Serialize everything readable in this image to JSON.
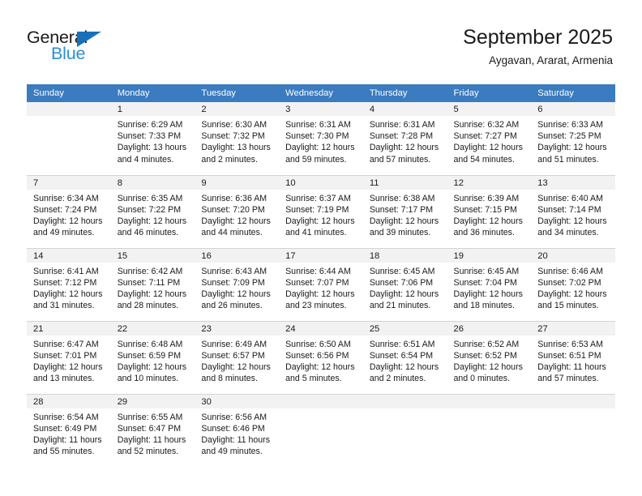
{
  "logo": {
    "word_top": "General",
    "word_bottom": "Blue",
    "triangle_color": "#1871b8",
    "blue_text_color": "#2a8fd4"
  },
  "header": {
    "title": "September 2025",
    "location": "Aygavan, Ararat, Armenia"
  },
  "theme": {
    "header_bg": "#3b7bbf",
    "header_text": "#ffffff",
    "daynum_bg": "#f2f2f2",
    "cell_bg": "#ffffff",
    "border": "#d4d4d4",
    "text": "#1a1a1a"
  },
  "calendar": {
    "weekday_headers": [
      "Sunday",
      "Monday",
      "Tuesday",
      "Wednesday",
      "Thursday",
      "Friday",
      "Saturday"
    ],
    "weeks": [
      [
        {
          "empty": true
        },
        {
          "day": "1",
          "sunrise": "Sunrise: 6:29 AM",
          "sunset": "Sunset: 7:33 PM",
          "daylight_l1": "Daylight: 13 hours",
          "daylight_l2": "and 4 minutes."
        },
        {
          "day": "2",
          "sunrise": "Sunrise: 6:30 AM",
          "sunset": "Sunset: 7:32 PM",
          "daylight_l1": "Daylight: 13 hours",
          "daylight_l2": "and 2 minutes."
        },
        {
          "day": "3",
          "sunrise": "Sunrise: 6:31 AM",
          "sunset": "Sunset: 7:30 PM",
          "daylight_l1": "Daylight: 12 hours",
          "daylight_l2": "and 59 minutes."
        },
        {
          "day": "4",
          "sunrise": "Sunrise: 6:31 AM",
          "sunset": "Sunset: 7:28 PM",
          "daylight_l1": "Daylight: 12 hours",
          "daylight_l2": "and 57 minutes."
        },
        {
          "day": "5",
          "sunrise": "Sunrise: 6:32 AM",
          "sunset": "Sunset: 7:27 PM",
          "daylight_l1": "Daylight: 12 hours",
          "daylight_l2": "and 54 minutes."
        },
        {
          "day": "6",
          "sunrise": "Sunrise: 6:33 AM",
          "sunset": "Sunset: 7:25 PM",
          "daylight_l1": "Daylight: 12 hours",
          "daylight_l2": "and 51 minutes."
        }
      ],
      [
        {
          "day": "7",
          "sunrise": "Sunrise: 6:34 AM",
          "sunset": "Sunset: 7:24 PM",
          "daylight_l1": "Daylight: 12 hours",
          "daylight_l2": "and 49 minutes."
        },
        {
          "day": "8",
          "sunrise": "Sunrise: 6:35 AM",
          "sunset": "Sunset: 7:22 PM",
          "daylight_l1": "Daylight: 12 hours",
          "daylight_l2": "and 46 minutes."
        },
        {
          "day": "9",
          "sunrise": "Sunrise: 6:36 AM",
          "sunset": "Sunset: 7:20 PM",
          "daylight_l1": "Daylight: 12 hours",
          "daylight_l2": "and 44 minutes."
        },
        {
          "day": "10",
          "sunrise": "Sunrise: 6:37 AM",
          "sunset": "Sunset: 7:19 PM",
          "daylight_l1": "Daylight: 12 hours",
          "daylight_l2": "and 41 minutes."
        },
        {
          "day": "11",
          "sunrise": "Sunrise: 6:38 AM",
          "sunset": "Sunset: 7:17 PM",
          "daylight_l1": "Daylight: 12 hours",
          "daylight_l2": "and 39 minutes."
        },
        {
          "day": "12",
          "sunrise": "Sunrise: 6:39 AM",
          "sunset": "Sunset: 7:15 PM",
          "daylight_l1": "Daylight: 12 hours",
          "daylight_l2": "and 36 minutes."
        },
        {
          "day": "13",
          "sunrise": "Sunrise: 6:40 AM",
          "sunset": "Sunset: 7:14 PM",
          "daylight_l1": "Daylight: 12 hours",
          "daylight_l2": "and 34 minutes."
        }
      ],
      [
        {
          "day": "14",
          "sunrise": "Sunrise: 6:41 AM",
          "sunset": "Sunset: 7:12 PM",
          "daylight_l1": "Daylight: 12 hours",
          "daylight_l2": "and 31 minutes."
        },
        {
          "day": "15",
          "sunrise": "Sunrise: 6:42 AM",
          "sunset": "Sunset: 7:11 PM",
          "daylight_l1": "Daylight: 12 hours",
          "daylight_l2": "and 28 minutes."
        },
        {
          "day": "16",
          "sunrise": "Sunrise: 6:43 AM",
          "sunset": "Sunset: 7:09 PM",
          "daylight_l1": "Daylight: 12 hours",
          "daylight_l2": "and 26 minutes."
        },
        {
          "day": "17",
          "sunrise": "Sunrise: 6:44 AM",
          "sunset": "Sunset: 7:07 PM",
          "daylight_l1": "Daylight: 12 hours",
          "daylight_l2": "and 23 minutes."
        },
        {
          "day": "18",
          "sunrise": "Sunrise: 6:45 AM",
          "sunset": "Sunset: 7:06 PM",
          "daylight_l1": "Daylight: 12 hours",
          "daylight_l2": "and 21 minutes."
        },
        {
          "day": "19",
          "sunrise": "Sunrise: 6:45 AM",
          "sunset": "Sunset: 7:04 PM",
          "daylight_l1": "Daylight: 12 hours",
          "daylight_l2": "and 18 minutes."
        },
        {
          "day": "20",
          "sunrise": "Sunrise: 6:46 AM",
          "sunset": "Sunset: 7:02 PM",
          "daylight_l1": "Daylight: 12 hours",
          "daylight_l2": "and 15 minutes."
        }
      ],
      [
        {
          "day": "21",
          "sunrise": "Sunrise: 6:47 AM",
          "sunset": "Sunset: 7:01 PM",
          "daylight_l1": "Daylight: 12 hours",
          "daylight_l2": "and 13 minutes."
        },
        {
          "day": "22",
          "sunrise": "Sunrise: 6:48 AM",
          "sunset": "Sunset: 6:59 PM",
          "daylight_l1": "Daylight: 12 hours",
          "daylight_l2": "and 10 minutes."
        },
        {
          "day": "23",
          "sunrise": "Sunrise: 6:49 AM",
          "sunset": "Sunset: 6:57 PM",
          "daylight_l1": "Daylight: 12 hours",
          "daylight_l2": "and 8 minutes."
        },
        {
          "day": "24",
          "sunrise": "Sunrise: 6:50 AM",
          "sunset": "Sunset: 6:56 PM",
          "daylight_l1": "Daylight: 12 hours",
          "daylight_l2": "and 5 minutes."
        },
        {
          "day": "25",
          "sunrise": "Sunrise: 6:51 AM",
          "sunset": "Sunset: 6:54 PM",
          "daylight_l1": "Daylight: 12 hours",
          "daylight_l2": "and 2 minutes."
        },
        {
          "day": "26",
          "sunrise": "Sunrise: 6:52 AM",
          "sunset": "Sunset: 6:52 PM",
          "daylight_l1": "Daylight: 12 hours",
          "daylight_l2": "and 0 minutes."
        },
        {
          "day": "27",
          "sunrise": "Sunrise: 6:53 AM",
          "sunset": "Sunset: 6:51 PM",
          "daylight_l1": "Daylight: 11 hours",
          "daylight_l2": "and 57 minutes."
        }
      ],
      [
        {
          "day": "28",
          "sunrise": "Sunrise: 6:54 AM",
          "sunset": "Sunset: 6:49 PM",
          "daylight_l1": "Daylight: 11 hours",
          "daylight_l2": "and 55 minutes."
        },
        {
          "day": "29",
          "sunrise": "Sunrise: 6:55 AM",
          "sunset": "Sunset: 6:47 PM",
          "daylight_l1": "Daylight: 11 hours",
          "daylight_l2": "and 52 minutes."
        },
        {
          "day": "30",
          "sunrise": "Sunrise: 6:56 AM",
          "sunset": "Sunset: 6:46 PM",
          "daylight_l1": "Daylight: 11 hours",
          "daylight_l2": "and 49 minutes."
        },
        {
          "empty": true
        },
        {
          "empty": true
        },
        {
          "empty": true
        },
        {
          "empty": true
        }
      ]
    ]
  }
}
